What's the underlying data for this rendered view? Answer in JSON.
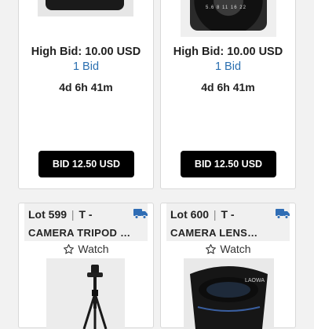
{
  "lots": [
    {
      "high_bid": "High Bid: 10.00 USD",
      "bid_count": "1 Bid",
      "time_left": "4d 6h 41m",
      "bid_button": "BID 12.50 USD"
    },
    {
      "high_bid": "High Bid: 10.00 USD",
      "bid_count": "1 Bid",
      "time_left": "4d 6h 41m",
      "bid_button": "BID 12.50 USD",
      "image_scale_text": "5.6 8 11 16 22"
    },
    {
      "lot_number": "Lot 599",
      "separator": "|",
      "category": "T -",
      "title": "CAMERA TRIPOD …",
      "watch_label": "Watch",
      "icon": "truck-icon"
    },
    {
      "lot_number": "Lot 600",
      "separator": "|",
      "category": "T -",
      "title": "CAMERA LENS…",
      "watch_label": "Watch",
      "icon": "truck-icon",
      "image_brand_text": "LAOWA"
    }
  ],
  "colors": {
    "bid_count_blue": "#2a6fb0",
    "truck_blue": "#2f6db5",
    "button_black": "#000000"
  }
}
